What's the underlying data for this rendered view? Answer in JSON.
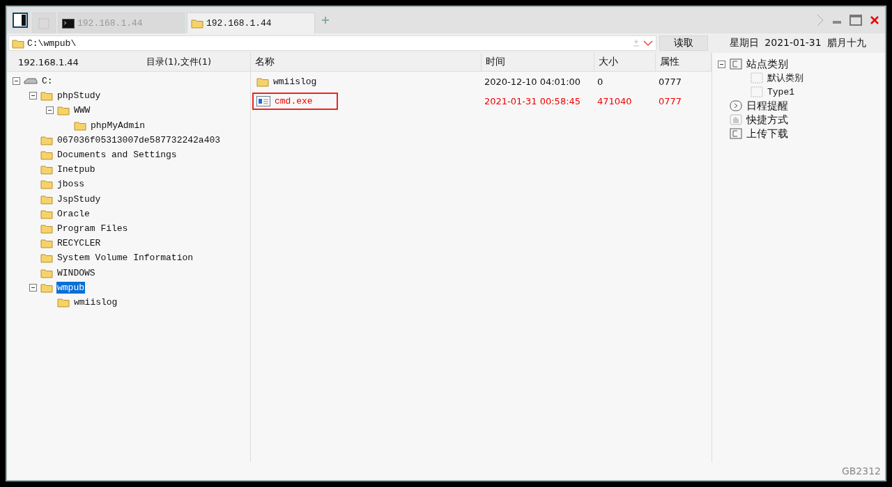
{
  "tabs": [
    {
      "kind": "blank",
      "selected": false
    },
    {
      "kind": "terminal",
      "label": "192.168.1.44",
      "selected": false
    },
    {
      "kind": "folder",
      "label": "192.168.1.44",
      "selected": true
    }
  ],
  "address": {
    "value": "C:\\wmpub\\",
    "button": "读取"
  },
  "date_bar": {
    "weekday": "星期日",
    "date": "2021-01-31",
    "lunar": "腊月十九"
  },
  "left_header": {
    "host": "192.168.1.44",
    "summary": "目录(1),文件(1)"
  },
  "tree": [
    {
      "label": "C:",
      "kind": "drive",
      "expanded": true,
      "selected": false,
      "children": [
        {
          "label": "phpStudy",
          "kind": "folder",
          "expanded": true,
          "selected": false,
          "children": [
            {
              "label": "WWW",
              "kind": "folder",
              "expanded": true,
              "selected": false,
              "children": [
                {
                  "label": "phpMyAdmin",
                  "kind": "folder",
                  "selected": false
                }
              ]
            }
          ]
        },
        {
          "label": "067036f05313007de587732242a403",
          "kind": "folder",
          "selected": false
        },
        {
          "label": "Documents and Settings",
          "kind": "folder",
          "selected": false
        },
        {
          "label": "Inetpub",
          "kind": "folder",
          "selected": false
        },
        {
          "label": "jboss",
          "kind": "folder",
          "selected": false
        },
        {
          "label": "JspStudy",
          "kind": "folder",
          "selected": false
        },
        {
          "label": "Oracle",
          "kind": "folder",
          "selected": false
        },
        {
          "label": "Program Files",
          "kind": "folder",
          "selected": false
        },
        {
          "label": "RECYCLER",
          "kind": "folder",
          "selected": false
        },
        {
          "label": "System Volume Information",
          "kind": "folder",
          "selected": false
        },
        {
          "label": "WINDOWS",
          "kind": "folder",
          "selected": false
        },
        {
          "label": "wmpub",
          "kind": "folder",
          "expanded": true,
          "selected": true,
          "children": [
            {
              "label": "wmiislog",
              "kind": "folder",
              "selected": false
            }
          ]
        }
      ]
    }
  ],
  "table": {
    "columns": [
      "名称",
      "时间",
      "大小",
      "属性"
    ],
    "rows": [
      {
        "kind": "folder",
        "name": "wmiislog",
        "time": "2020-12-10 04:01:00",
        "size": "0",
        "attr": "0777",
        "selected": false
      },
      {
        "kind": "exe",
        "name": "cmd.exe",
        "time": "2021-01-31 00:58:45",
        "size": "471040",
        "attr": "0777",
        "selected": true
      }
    ]
  },
  "side_tree": [
    {
      "label": "站点类别",
      "kind": "category",
      "expanded": true,
      "children": [
        {
          "label": "默认类别",
          "kind": "type"
        },
        {
          "label": "Type1",
          "kind": "type"
        }
      ]
    },
    {
      "label": "日程提醒",
      "kind": "schedule"
    },
    {
      "label": "快捷方式",
      "kind": "shortcut"
    },
    {
      "label": "上传下载",
      "kind": "transfer"
    }
  ],
  "status_bar": {
    "encoding": "GB2312"
  }
}
